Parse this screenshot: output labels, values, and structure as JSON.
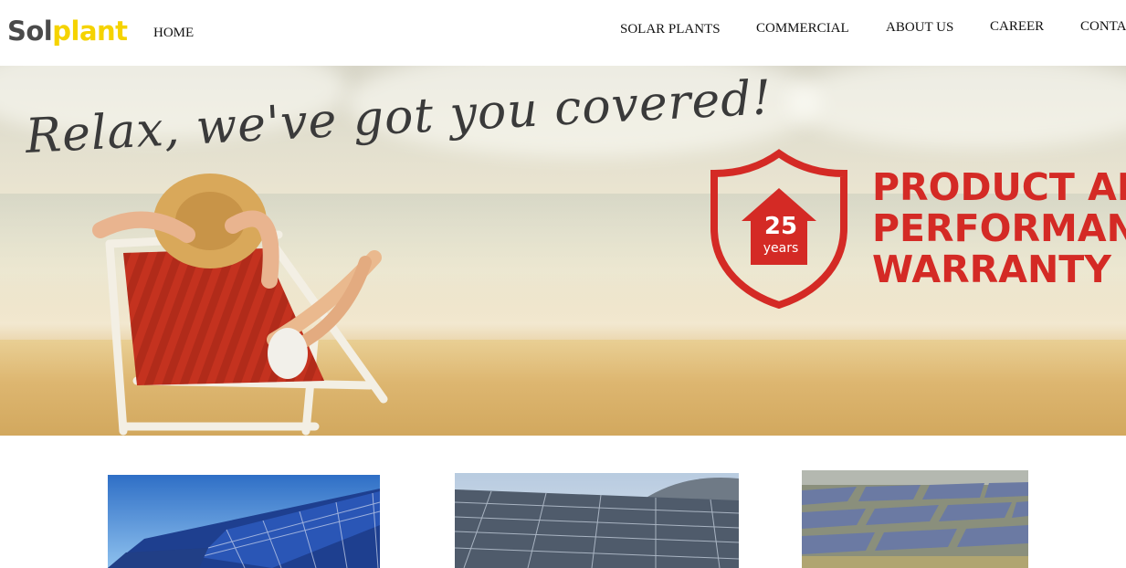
{
  "logo": {
    "part1": "Sol",
    "part2": "plant"
  },
  "nav": {
    "home": "HOME",
    "solar_plants": "SOLAR PLANTS",
    "commercial": "COMMERCIAL",
    "about_us": "ABOUT US",
    "career": "CAREER",
    "contact": "CONTA"
  },
  "hero": {
    "tagline": "Relax, we've got you covered!",
    "badge_number": "25",
    "badge_unit": "years",
    "warranty_lines": [
      "PRODUCT AN",
      "PERFORMANC",
      "WARRANTY"
    ]
  },
  "colors": {
    "logo_dark": "#4a4a4a",
    "logo_yellow": "#f5d300",
    "warranty_red": "#d42a25"
  },
  "cards": [
    {
      "icon": "solar-panels-sky-image"
    },
    {
      "icon": "solar-roof-image"
    },
    {
      "icon": "solar-field-image"
    }
  ]
}
